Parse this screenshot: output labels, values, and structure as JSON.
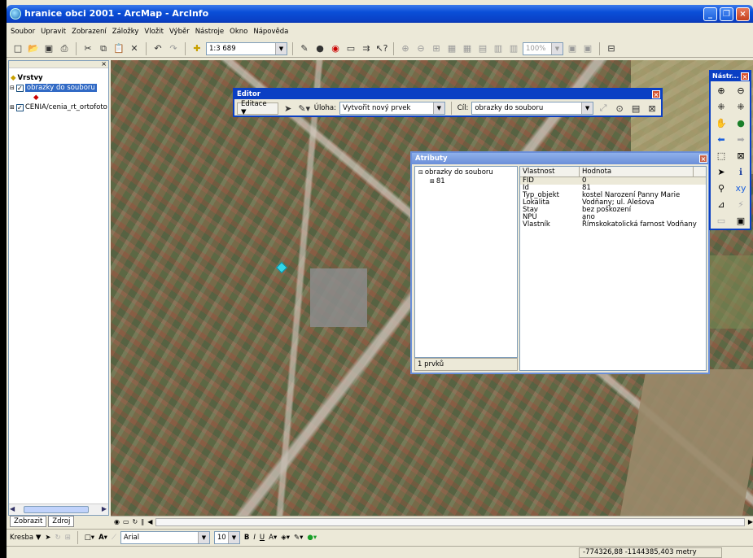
{
  "window": {
    "title": "hranice obci 2001 - ArcMap - ArcInfo",
    "min": "_",
    "max": "❐",
    "close": "×"
  },
  "menu": [
    "Soubor",
    "Upravit",
    "Zobrazení",
    "Záložky",
    "Vložit",
    "Výběr",
    "Nástroje",
    "Okno",
    "Nápověda"
  ],
  "toolbar": {
    "scale": "1:3 689",
    "zoom_percent": "100%"
  },
  "toc": {
    "root": "Vrstvy",
    "layers": [
      {
        "name": "obrazky do souboru",
        "checked": true,
        "selected": true
      },
      {
        "name": "CENIA/cenia_rt_ortofoto",
        "checked": true,
        "selected": false
      }
    ],
    "tabs": [
      "Zobrazit",
      "Zdroj"
    ]
  },
  "editor": {
    "title": "Editor",
    "menu_label": "Editace ▼",
    "task_label": "Úloha:",
    "task_value": "Vytvořit nový prvek",
    "target_label": "Cíl:",
    "target_value": "obrazky do souboru",
    "close": "×"
  },
  "attributes": {
    "title": "Atributy",
    "close": "×",
    "tree_root": "obrazky do souboru",
    "tree_child": "81",
    "count": "1 prvků",
    "col_property": "Vlastnost",
    "col_value": "Hodnota",
    "rows": [
      {
        "k": "FID",
        "v": "0"
      },
      {
        "k": "Id",
        "v": "81"
      },
      {
        "k": "Typ_objekt",
        "v": "kostel Narození Panny Marie"
      },
      {
        "k": "Lokalita",
        "v": "Vodňany; ul. Alešova"
      },
      {
        "k": "Stav",
        "v": "bez poškození"
      },
      {
        "k": "NPÚ",
        "v": "ano"
      },
      {
        "k": "Vlastník",
        "v": "Římskokatolická farnost Vodňany"
      }
    ]
  },
  "tools": {
    "title": "Nástr...",
    "close": "×"
  },
  "drawing": {
    "menu_label": "Kresba ▼",
    "font_name": "Arial",
    "font_size": "10",
    "bold": "B",
    "italic": "I",
    "underline": "U"
  },
  "status": {
    "coords": "-774326,88  -1144385,403 metry"
  }
}
